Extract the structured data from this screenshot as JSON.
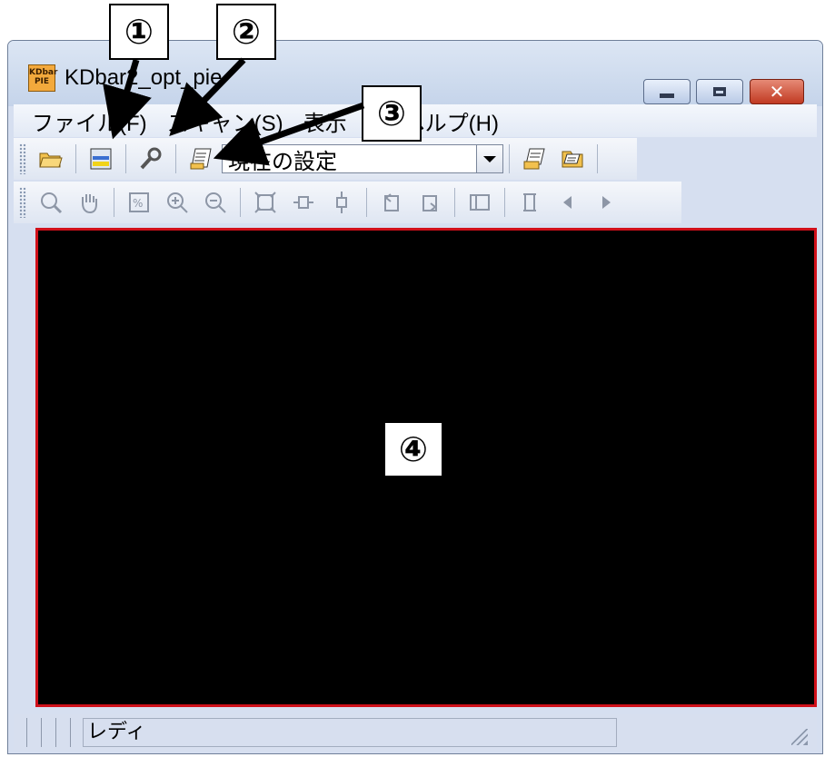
{
  "window": {
    "title": "KDbar2_opt_pie",
    "icon_text": "KDbar\nPIE"
  },
  "caption_buttons": {
    "minimize": "minimize-icon",
    "maximize": "maximize-icon",
    "close": "✕"
  },
  "menu": [
    "ファイル(F)",
    "スキャン(S)",
    "表示",
    "ヘルプ(H)"
  ],
  "toolbar1": {
    "buttons": [
      "open-folder-icon",
      "scanner-icon",
      "wrench-icon",
      "settings-sheet-icon"
    ],
    "combo_value": "現在の設定",
    "after_combo": [
      "save-settings-icon",
      "load-settings-icon"
    ]
  },
  "toolbar2": {
    "buttons": [
      "zoom-icon",
      "hand-icon",
      "percent-icon",
      "zoom-in-icon",
      "zoom-out-icon",
      "fit-icon",
      "fit-width-icon",
      "fit-height-icon",
      "rotate-left-icon",
      "rotate-right-icon",
      "panel-icon",
      "page-icon",
      "prev-icon",
      "next-icon"
    ]
  },
  "status": {
    "text": "レディ"
  },
  "callouts": {
    "c1": "①",
    "c2": "②",
    "c3": "③",
    "c4": "④"
  },
  "colors": {
    "viewport_border": "#d0101a",
    "viewport_bg": "#000000",
    "close_button": "#c13a22"
  }
}
